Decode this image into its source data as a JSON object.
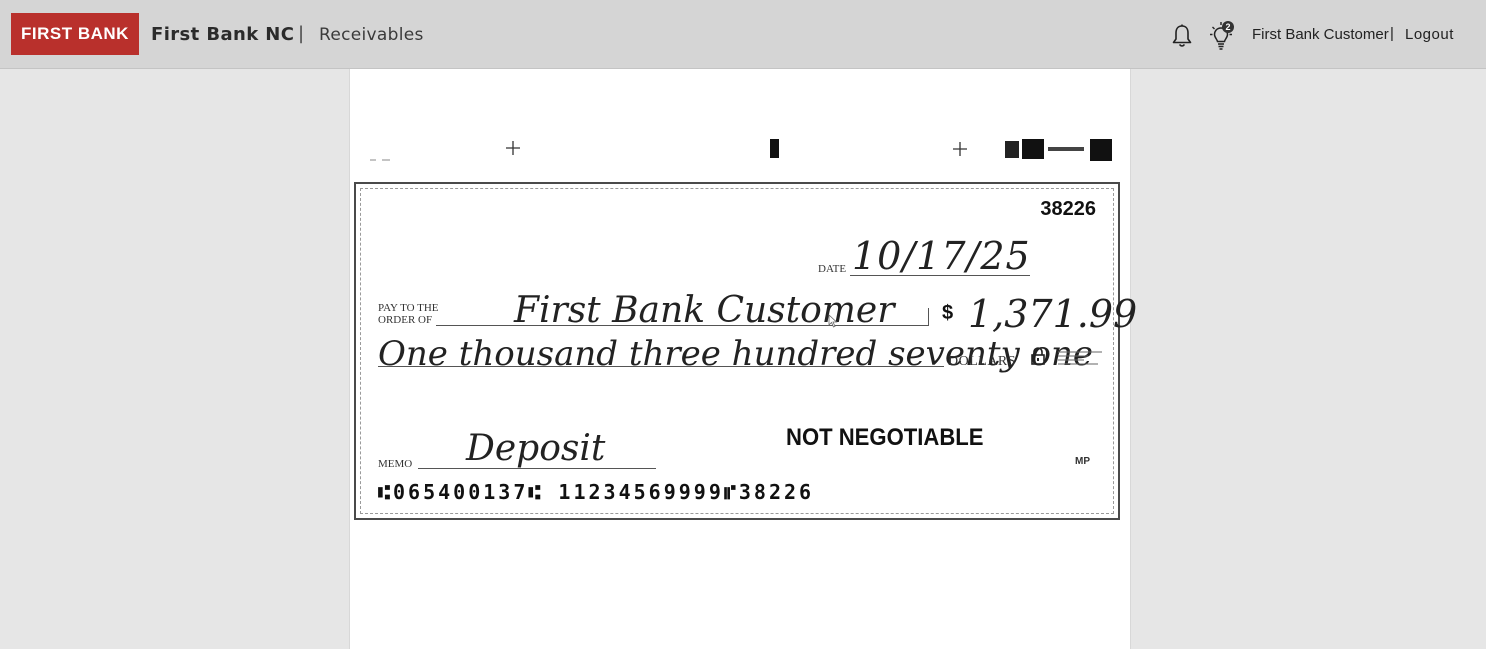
{
  "header": {
    "logo_text": "FIRST BANK",
    "brand": "First Bank NC",
    "separator": "|",
    "module": "Receivables",
    "bell_icon": "bell-icon",
    "tips_icon": "lightbulb-icon",
    "tips_badge": "2",
    "user_name": "First Bank Customer",
    "user_separator": "|",
    "logout_label": "Logout",
    "brand_color": "#b9302c"
  },
  "check": {
    "number": "38226",
    "date_label": "DATE",
    "date": "10/17/25",
    "payto_label_line1": "PAY TO THE",
    "payto_label_line2": "ORDER OF",
    "payee": "First Bank Customer",
    "dollar_sign": "$",
    "amount": "1,371.99",
    "amount_words": "One thousand three hundred seventy one",
    "dollars_label": "DOLLARS",
    "security_icon": "lock-icon",
    "not_negotiable": "NOT NEGOTIABLE",
    "memo_label": "MEMO",
    "memo": "Deposit",
    "mp_mark": "MP",
    "micr": "⑆065400137⑆ 11234569999⑈38226"
  }
}
